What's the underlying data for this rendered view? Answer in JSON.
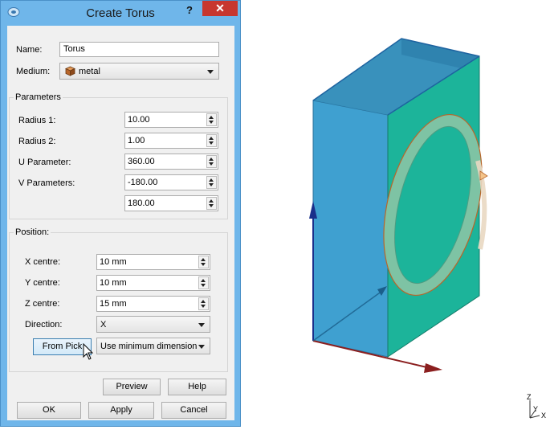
{
  "dialog": {
    "title": "Create Torus",
    "help_glyph": "?",
    "close_glyph": "✕"
  },
  "form": {
    "name_label": "Name:",
    "name_value": "Torus",
    "medium_label": "Medium:",
    "medium_value": "metal"
  },
  "parameters": {
    "group_title": "Parameters",
    "radius1_label": "Radius 1:",
    "radius1_value": "10.00",
    "radius2_label": "Radius 2:",
    "radius2_value": "1.00",
    "u_label": "U Parameter:",
    "u_value": "360.00",
    "v_label": "V Parameters:",
    "v_value1": "-180.00",
    "v_value2": "180.00"
  },
  "position": {
    "group_title": "Position:",
    "x_label": "X centre:",
    "x_value": "10 mm",
    "y_label": "Y centre:",
    "y_value": "10 mm",
    "z_label": "Z centre:",
    "z_value": "15 mm",
    "direction_label": "Direction:",
    "direction_value": "X",
    "from_pick_label": "From Pick",
    "dimension_value": "Use minimum dimension"
  },
  "buttons": {
    "preview": "Preview",
    "help": "Help",
    "ok": "OK",
    "apply": "Apply",
    "cancel": "Cancel"
  },
  "triad": {
    "z": "Z",
    "y": "Y",
    "x": "X"
  },
  "colors": {
    "title_bar": "#6fb6ea",
    "close_button": "#c7372f",
    "box_face_left": "#3fa0d0",
    "box_face_right": "#1cb49a",
    "torus": "#7ec3a4"
  },
  "icons": [
    "dialog-app-icon",
    "metal-cube-icon",
    "mouse-cursor-icon"
  ]
}
